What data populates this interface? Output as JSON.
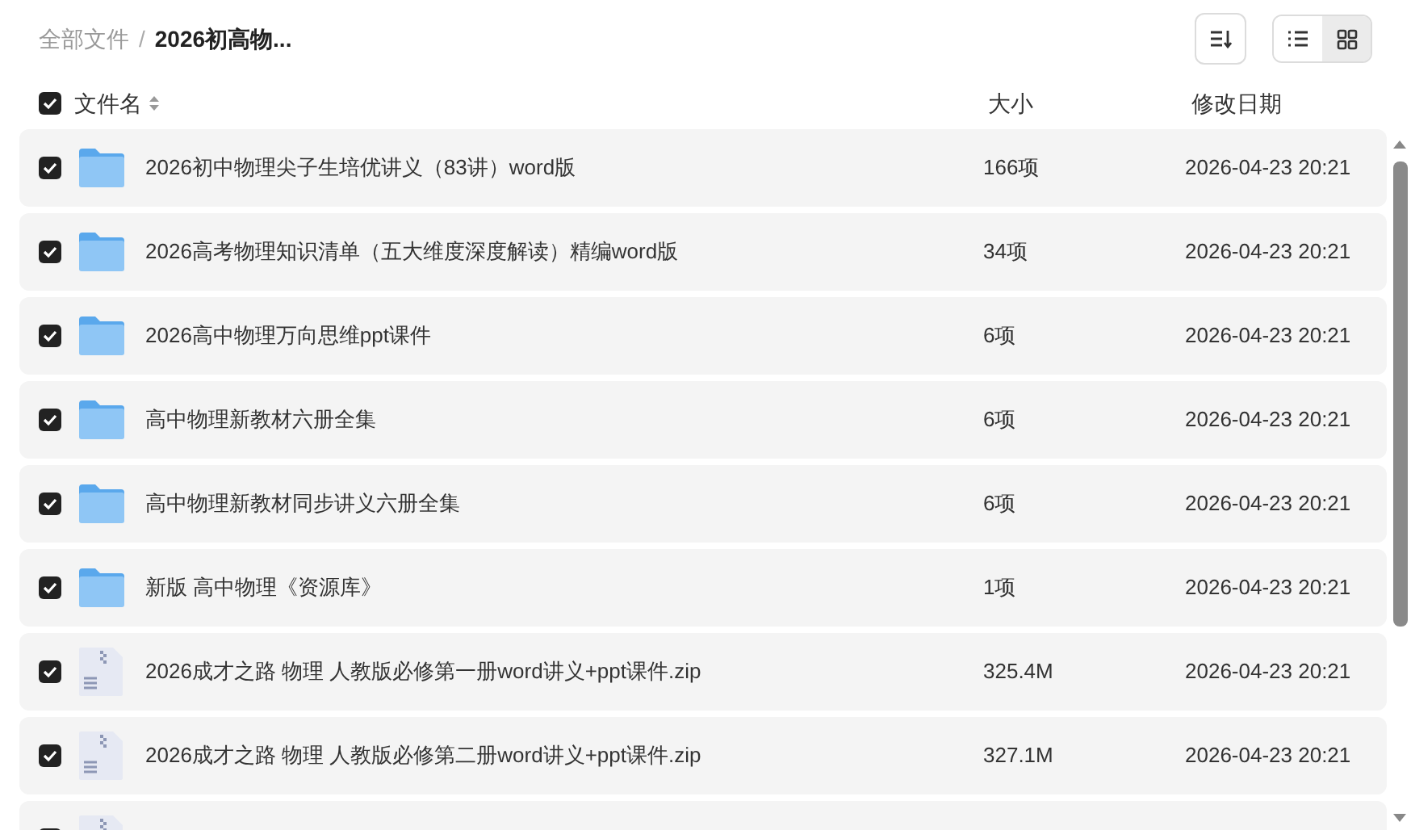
{
  "breadcrumb_separator": "/",
  "breadcrumb": [
    {
      "label": "全部文件",
      "current": false
    },
    {
      "label": "2026初高物...",
      "current": true
    }
  ],
  "view_toggle": [
    {
      "kind": "list",
      "selected": false
    },
    {
      "kind": "grid",
      "selected": true
    }
  ],
  "header": {
    "all_checked": true,
    "columns": [
      "文件名",
      "大小",
      "修改日期"
    ]
  },
  "files": [
    {
      "kind": "folder",
      "checked": true,
      "name": "2026初中物理尖子生培优讲义（83讲）word版",
      "size": "166项",
      "date": "2026-04-23 20:21"
    },
    {
      "kind": "folder",
      "checked": true,
      "name": "2026高考物理知识清单（五大维度深度解读）精编word版",
      "size": "34项",
      "date": "2026-04-23 20:21"
    },
    {
      "kind": "folder",
      "checked": true,
      "name": "2026高中物理万向思维ppt课件",
      "size": "6项",
      "date": "2026-04-23 20:21"
    },
    {
      "kind": "folder",
      "checked": true,
      "name": "高中物理新教材六册全集",
      "size": "6项",
      "date": "2026-04-23 20:21"
    },
    {
      "kind": "folder",
      "checked": true,
      "name": "高中物理新教材同步讲义六册全集",
      "size": "6项",
      "date": "2026-04-23 20:21"
    },
    {
      "kind": "folder",
      "checked": true,
      "name": "新版 高中物理《资源库》",
      "size": "1项",
      "date": "2026-04-23 20:21"
    },
    {
      "kind": "zip",
      "checked": true,
      "name": "2026成才之路 物理 人教版必修第一册word讲义+ppt课件.zip",
      "size": "325.4M",
      "date": "2026-04-23 20:21"
    },
    {
      "kind": "zip",
      "checked": true,
      "name": "2026成才之路 物理 人教版必修第二册word讲义+ppt课件.zip",
      "size": "327.1M",
      "date": "2026-04-23 20:21"
    },
    {
      "kind": "zip",
      "checked": true
    }
  ]
}
